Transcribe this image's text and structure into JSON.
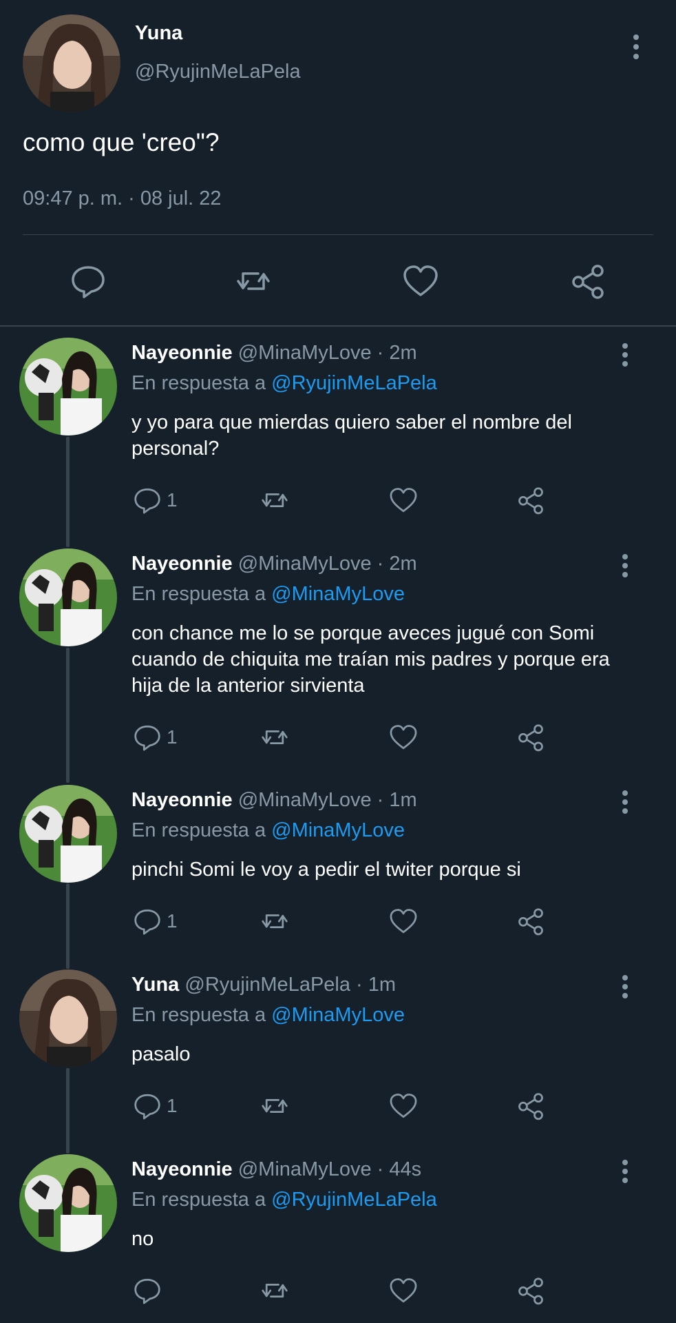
{
  "main_tweet": {
    "name": "Yuna",
    "handle": "@RyujinMeLaPela",
    "text": "como que 'creo\"?",
    "timestamp": "09:47 p. m. · 08 jul. 22",
    "actions": [
      "reply-icon",
      "retweet-icon",
      "like-icon",
      "share-icon"
    ]
  },
  "replies": [
    {
      "name": "Nayeonnie",
      "handle_time": "@MinaMyLove · 2m",
      "in_reply_prefix": "En respuesta a",
      "in_reply_to": "@RyujinMeLaPela",
      "text": "y yo para que mierdas quiero saber el nombre del personal?",
      "reply_count": "1"
    },
    {
      "name": "Nayeonnie",
      "handle_time": "@MinaMyLove · 2m",
      "in_reply_prefix": "En respuesta a",
      "in_reply_to": "@MinaMyLove",
      "text": "con chance me lo se porque aveces jugué con Somi cuando de chiquita me traían mis padres y porque era hija de la anterior sirvienta",
      "reply_count": "1"
    },
    {
      "name": "Nayeonnie",
      "handle_time": "@MinaMyLove · 1m",
      "in_reply_prefix": "En respuesta a",
      "in_reply_to": "@MinaMyLove",
      "text": "pinchi Somi le voy a pedir el twiter porque si",
      "reply_count": "1"
    },
    {
      "name": "Yuna",
      "handle_time": "@RyujinMeLaPela · 1m",
      "in_reply_prefix": "En respuesta a",
      "in_reply_to": "@MinaMyLove",
      "text": "pasalo",
      "reply_count": "1"
    },
    {
      "name": "Nayeonnie",
      "handle_time": "@MinaMyLove · 44s",
      "in_reply_prefix": "En respuesta a",
      "in_reply_to": "@RyujinMeLaPela",
      "text": "no",
      "reply_count": ""
    }
  ],
  "colors": {
    "background": "#15202b",
    "secondary_text": "#8899a6",
    "link": "#1d9bf0",
    "divider": "#38444d"
  }
}
